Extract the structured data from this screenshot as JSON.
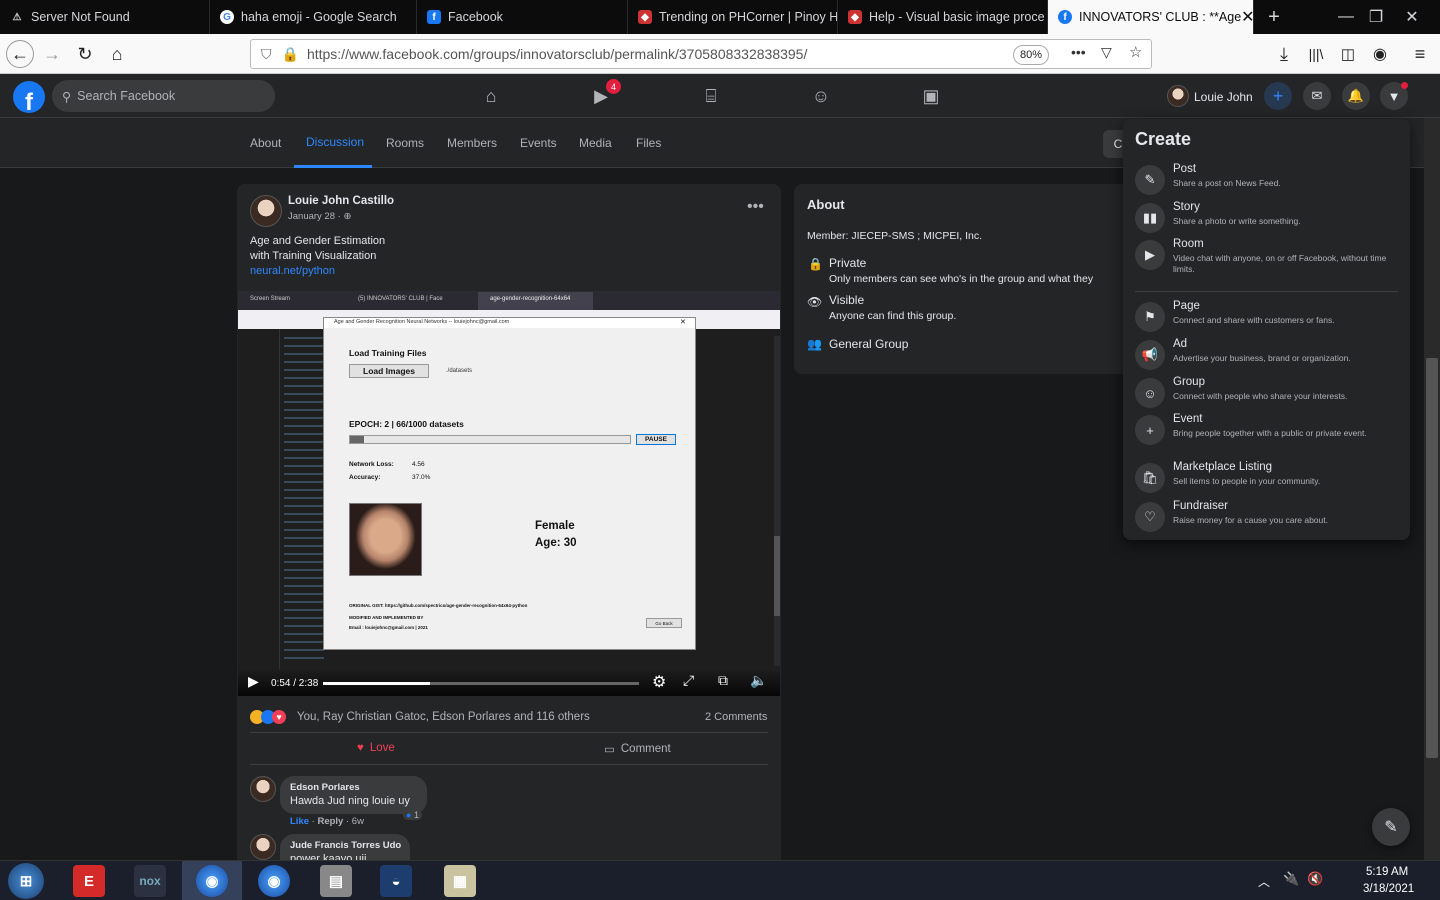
{
  "tabs": [
    {
      "title": "Server Not Found",
      "icon": "warning-icon"
    },
    {
      "title": "haha emoji - Google Search",
      "icon": "google-icon"
    },
    {
      "title": "Facebook",
      "icon": "facebook-icon"
    },
    {
      "title": "Trending on PHCorner | Pinoy H",
      "icon": "phcorner-icon"
    },
    {
      "title": "Help - Visual basic image proce",
      "icon": "phcorner-icon"
    },
    {
      "title": "INNOVATORS' CLUB : **Age",
      "icon": "facebook-icon",
      "active": true
    }
  ],
  "browser": {
    "url": "https://www.facebook.com/groups/innovatorsclub/permalink/3705808332838395/",
    "zoom": "80%"
  },
  "fb": {
    "search_placeholder": "Search Facebook",
    "video_badge": "4",
    "profile_name": "Louie John"
  },
  "group_tabs": [
    "About",
    "Discussion",
    "Rooms",
    "Members",
    "Events",
    "Media",
    "Files"
  ],
  "post": {
    "author": "Louie John Castillo",
    "date": "January 28 · ",
    "text_line1": "Age and Gender Estimation",
    "text_line2": "with Training Visualization",
    "link": "neural.net/python",
    "video_time": "0:54 / 2:38",
    "video_progress": 0.34,
    "reactions_text": "You, Ray Christian Gatoc, Edson Porlares and 116 others",
    "comments_count": "2 Comments",
    "love_label": "Love",
    "comment_label": "Comment",
    "comments": [
      {
        "name": "Edson Porlares",
        "text": "Hawda Jud ning louie uy",
        "like": "Like",
        "reply": "Reply",
        "age": "6w",
        "reacts": "1"
      },
      {
        "name": "Jude Francis Torres Udo",
        "text": "power kaayo uii"
      }
    ]
  },
  "app": {
    "window_title": "Age and Gender Recognition Neural Networks -- louiejohnc@gmail.com",
    "load_title": "Load Training Files",
    "load_button": "Load Images",
    "datasets_path": "./datasets",
    "epoch": "EPOCH: 2 | 66/1000 datasets",
    "epoch_progress": 0.05,
    "pause": "PAUSE",
    "loss_label": "Network Loss:",
    "loss_value": "4.56",
    "acc_label": "Accuracy:",
    "acc_value": "37.0%",
    "gender": "Female",
    "age": "Age: 30",
    "gist": "ORIGINAL GIST: https://github.com/spectrico/age-gender-recognition-64x64-python",
    "modified": "MODIFIED AND IMPLEMENTED BY",
    "email": "Email : louiejohnc@gmail.com  |  2021",
    "go_back": "Go Back",
    "inner_tabs": [
      "Screen Stream",
      "(5) INNOVATORS' CLUB | Face",
      "age-gender-recognition-64x64"
    ]
  },
  "about": {
    "title": "About",
    "member": "Member: JIECEP-SMS ; MICPEI, Inc.",
    "private_title": "Private",
    "private_desc": "Only members can see who's in the group and what they",
    "visible_title": "Visible",
    "visible_desc": "Anyone can find this group.",
    "general": "General Group"
  },
  "create": {
    "title": "Create",
    "items": [
      {
        "title": "Post",
        "desc": "Share a post on News Feed.",
        "icon": "edit-icon"
      },
      {
        "title": "Story",
        "desc": "Share a photo or write something.",
        "icon": "book-icon"
      },
      {
        "title": "Room",
        "desc": "Video chat with anyone, on or off Facebook, without time limits.",
        "icon": "video-icon"
      },
      {
        "title": "Page",
        "desc": "Connect and share with customers or fans.",
        "icon": "flag-icon"
      },
      {
        "title": "Ad",
        "desc": "Advertise your business, brand or organization.",
        "icon": "megaphone-icon"
      },
      {
        "title": "Group",
        "desc": "Connect with people who share your interests.",
        "icon": "group-icon"
      },
      {
        "title": "Event",
        "desc": "Bring people together with a public or private event.",
        "icon": "event-icon"
      },
      {
        "title": "Marketplace Listing",
        "desc": "Sell items to people in your community.",
        "icon": "bag-icon"
      },
      {
        "title": "Fundraiser",
        "desc": "Raise money for a cause you care about.",
        "icon": "fundraiser-icon"
      }
    ]
  },
  "taskbar": {
    "time": "5:19 AM",
    "date": "3/18/2021"
  },
  "colors": {
    "fb_blue": "#1877f2",
    "dark_bg": "#18191a",
    "card": "#242526",
    "love": "#f33e58"
  }
}
